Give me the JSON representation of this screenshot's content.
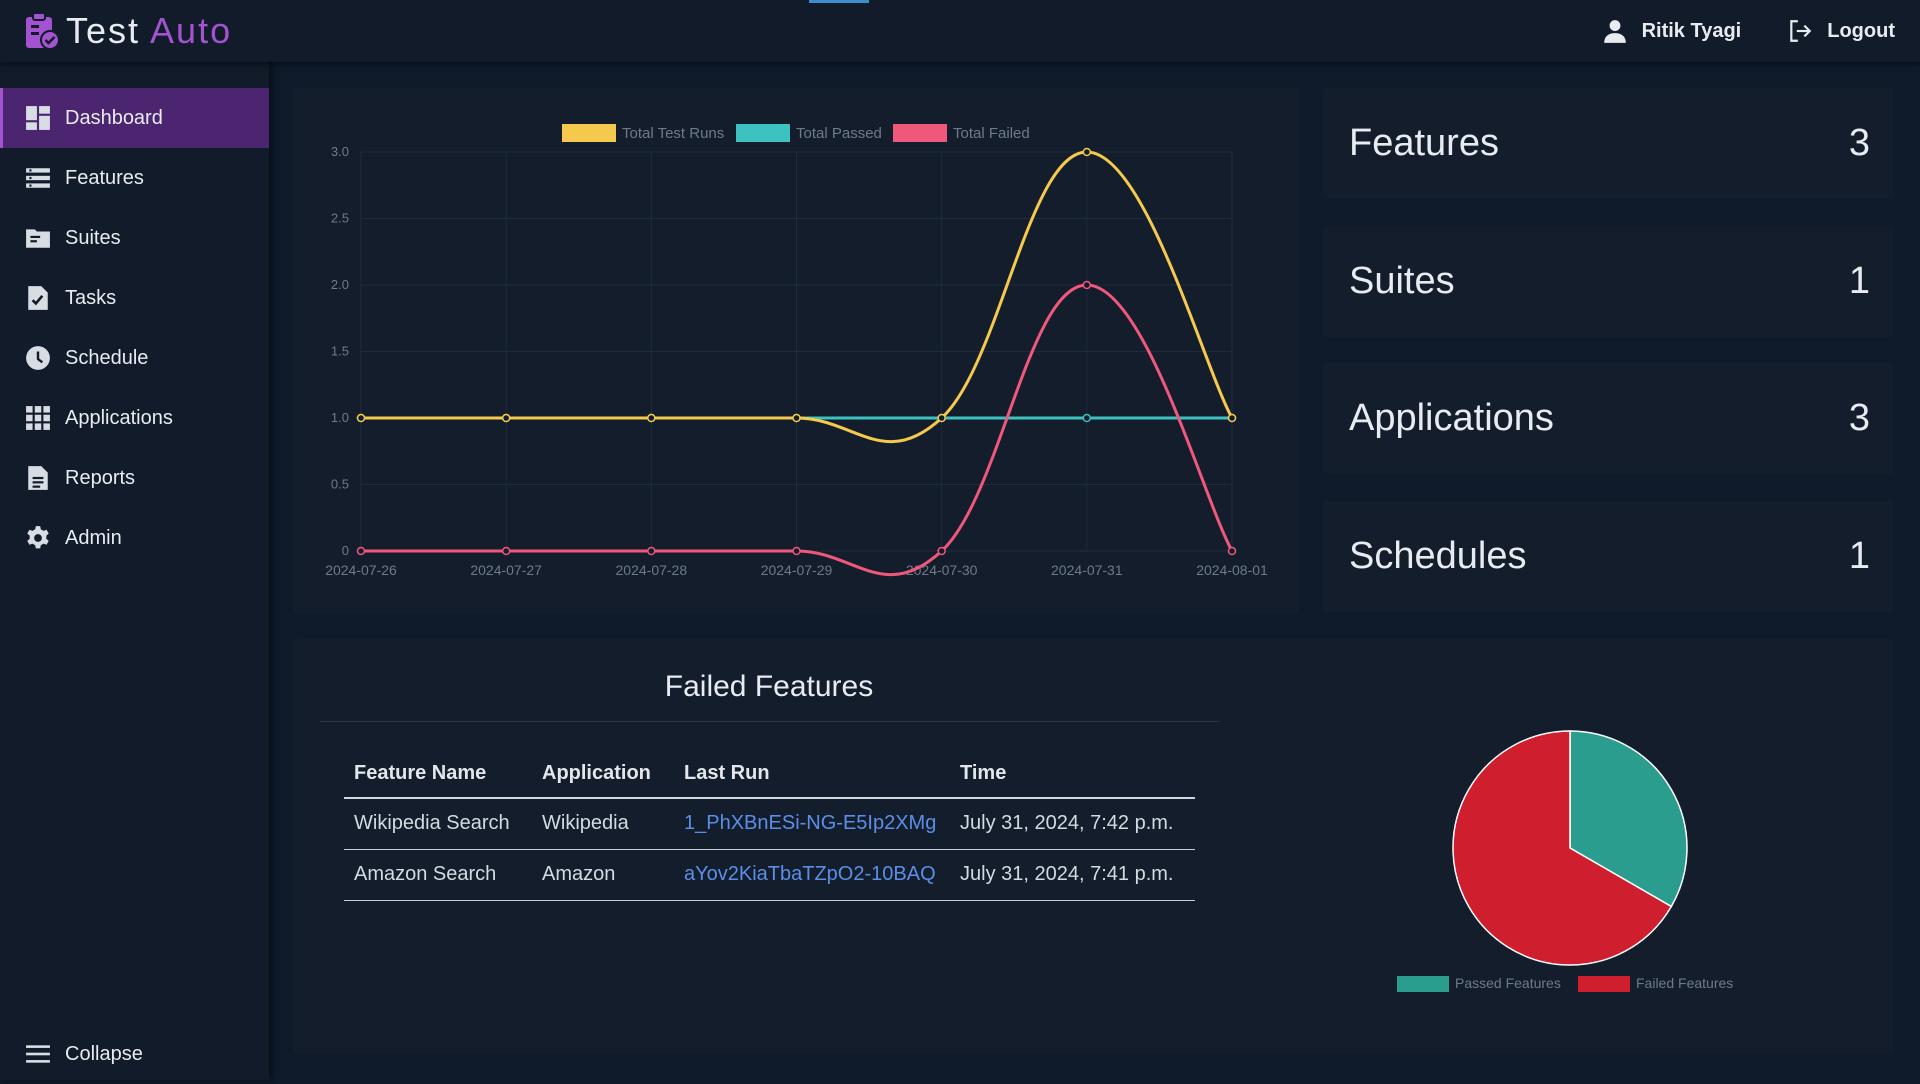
{
  "app": {
    "brand_main": "Test",
    "brand_accent": "Auto",
    "accent_color": "#a453d0"
  },
  "header": {
    "user_name": "Ritik Tyagi",
    "logout_label": "Logout"
  },
  "sidebar": {
    "items": [
      {
        "label": "Dashboard",
        "icon": "dashboard-icon",
        "active": true
      },
      {
        "label": "Features",
        "icon": "list-icon"
      },
      {
        "label": "Suites",
        "icon": "folder-icon"
      },
      {
        "label": "Tasks",
        "icon": "task-check-icon"
      },
      {
        "label": "Schedule",
        "icon": "clock-icon"
      },
      {
        "label": "Applications",
        "icon": "grid-icon"
      },
      {
        "label": "Reports",
        "icon": "document-icon"
      },
      {
        "label": "Admin",
        "icon": "gear-icon"
      }
    ],
    "collapse_label": "Collapse"
  },
  "stats": [
    {
      "label": "Features",
      "value": "3"
    },
    {
      "label": "Suites",
      "value": "1"
    },
    {
      "label": "Applications",
      "value": "3"
    },
    {
      "label": "Schedules",
      "value": "1"
    }
  ],
  "failed_features": {
    "title": "Failed Features",
    "columns": [
      "Feature Name",
      "Application",
      "Last Run",
      "Time"
    ],
    "rows": [
      {
        "feature": "Wikipedia Search",
        "application": "Wikipedia",
        "last_run": "1_PhXBnESi-NG-E5Ip2XMg",
        "time": "July 31, 2024, 7:42 p.m."
      },
      {
        "feature": "Amazon Search",
        "application": "Amazon",
        "last_run": "aYov2KiaTbaTZpO2-10BAQ",
        "time": "July 31, 2024, 7:41 p.m."
      }
    ]
  },
  "chart_data": [
    {
      "type": "line",
      "title": "",
      "xlabel": "",
      "ylabel": "",
      "x": [
        "2024-07-26",
        "2024-07-27",
        "2024-07-28",
        "2024-07-29",
        "2024-07-30",
        "2024-07-31",
        "2024-08-01"
      ],
      "ylim": [
        0,
        3
      ],
      "yticks": [
        "0",
        "0.5",
        "1.0",
        "1.5",
        "2.0",
        "2.5",
        "3.0"
      ],
      "grid": true,
      "legend_position": "top-center",
      "series": [
        {
          "name": "Total Test Runs",
          "values": [
            1,
            1,
            1,
            1,
            1,
            3,
            1
          ],
          "color": "#f5c94e"
        },
        {
          "name": "Total Passed",
          "values": [
            1,
            1,
            1,
            1,
            1,
            1,
            1
          ],
          "color": "#3ec1c1"
        },
        {
          "name": "Total Failed",
          "values": [
            0,
            0,
            0,
            0,
            0,
            2,
            0
          ],
          "color": "#f0587b"
        }
      ]
    },
    {
      "type": "pie",
      "title": "",
      "legend_position": "bottom",
      "labels": [
        "Passed Features",
        "Failed Features"
      ],
      "values": [
        1,
        2
      ],
      "colors": [
        "#2a9d8f",
        "#cf1f2e"
      ]
    }
  ]
}
